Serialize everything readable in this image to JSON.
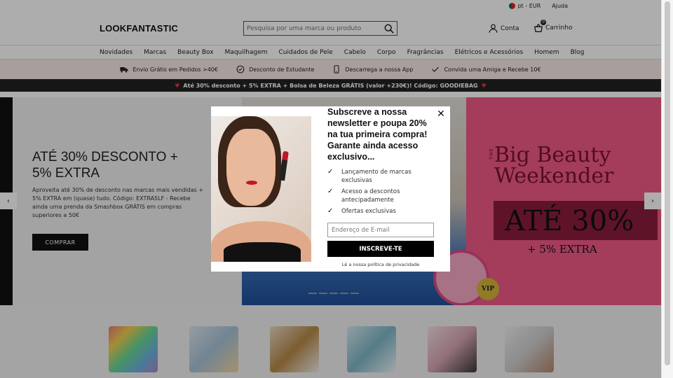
{
  "topbar": {
    "locale": "pt - EUR",
    "help": "Ajuda"
  },
  "header": {
    "logo": "LOOKFANTASTIC",
    "search_placeholder": "Pesquisa por uma marca ou produto",
    "account_label": "Conta",
    "cart_label": "Carrinho",
    "cart_count": "0"
  },
  "nav": [
    "Novidades",
    "Marcas",
    "Beauty Box",
    "Maquilhagem",
    "Cuidados de Pele",
    "Cabelo",
    "Corpo",
    "Fragrâncias",
    "Elétricos e Acessórios",
    "Homem",
    "Blog"
  ],
  "usp": [
    {
      "icon": "truck-icon",
      "label": "Envio Grátis em Pedidos >40€"
    },
    {
      "icon": "tag-icon",
      "label": "Desconto de Estudante"
    },
    {
      "icon": "phone-icon",
      "label": "Descarrega a nossa App"
    },
    {
      "icon": "check-icon",
      "label": "Convida uma Amiga e Recebe 10€"
    }
  ],
  "promo": "Até 30% desconto + 5% EXTRA + Bolsa de Beleza GRÁTIS (valor +230€)! Código: GOODIEBAG",
  "hero": {
    "title": "ATÉ 30% DESCONTO + 5% EXTRA",
    "text": "Aproveita até 30% de desconto nas marcas mais vendidas + 5% EXTRA em (quase) tudo. Código: EXTRA5LF - Recebe ainda uma prenda da Smashbox GRÁTIS em compras superiores a 50€",
    "cta": "COMPRAR",
    "banner_the": "THE",
    "banner_title": "Big Beauty Weekender",
    "banner_pct": "ATÉ 30%",
    "banner_extra": "+ 5% EXTRA",
    "badge": "VIP"
  },
  "modal": {
    "title": "Subscreve a nossa newsletter e poupa 20% na tua primeira compra! Garante ainda acesso exclusivo...",
    "benefits": [
      "Lançamento de marcas exclusivas",
      "Acesso a descontos antecipadamente",
      "Ofertas exclusivas"
    ],
    "email_placeholder": "Endereço de E-mail",
    "button": "INSCREVE-TE",
    "privacy": "Lê a nossa política de privacidade"
  },
  "colors": {
    "accent": "#000000",
    "usp_bg": "#f8e9e6",
    "banner_pink": "#f05a86",
    "promo_bg": "#222222"
  }
}
